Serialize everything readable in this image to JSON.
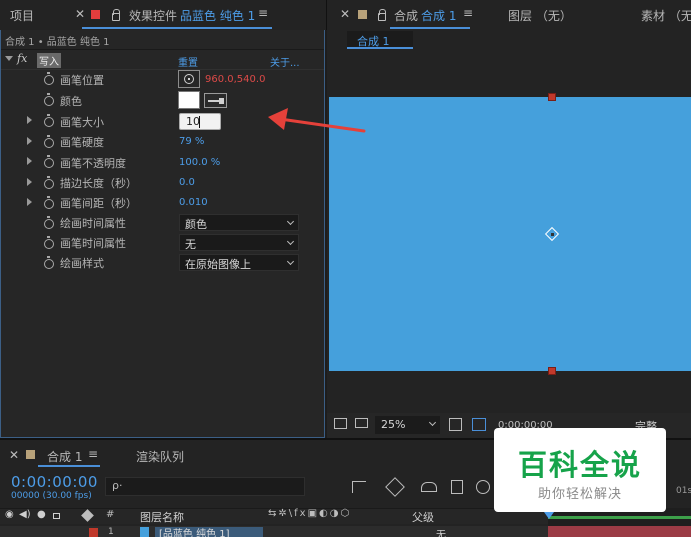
{
  "top_tabs": {
    "project": "项目",
    "effect_controls_prefix": "效果控件",
    "effect_controls_layer": "品蓝色 纯色 1",
    "menu_glyph": "≡",
    "composition_prefix": "合成",
    "composition_name": "合成 1",
    "layer_tab": "图层 （无）",
    "footage_tab": "素材 （无）"
  },
  "effect_controls": {
    "breadcrumb": "合成 1 • 品蓝色 纯色 1",
    "fx_label": "fx",
    "effect_name": "写入",
    "reset": "重置",
    "about": "关于...",
    "properties": [
      {
        "label": "画笔位置",
        "value": "960.0,540.0"
      },
      {
        "label": "颜色"
      },
      {
        "label": "画笔大小",
        "value": "10"
      },
      {
        "label": "画笔硬度",
        "value": "79 %"
      },
      {
        "label": "画笔不透明度",
        "value": "100.0 %"
      },
      {
        "label": "描边长度（秒）",
        "value": "0.0"
      },
      {
        "label": "画笔间距（秒）",
        "value": "0.010"
      },
      {
        "label": "绘画时间属性",
        "value": "颜色"
      },
      {
        "label": "画笔时间属性",
        "value": "无"
      },
      {
        "label": "绘画样式",
        "value": "在原始图像上"
      }
    ]
  },
  "composition": {
    "sub_tab": "合成 1",
    "zoom": "25%",
    "timecode": "0;00;00;00",
    "resolution": "完整",
    "viewer_color": "#45a0dc"
  },
  "timeline": {
    "comp_tab": "合成 1",
    "render_queue": "渲染队列",
    "timecode": "0:00:00:00",
    "frames": "00000 (30.00 fps)",
    "search_glyph": "ρ·",
    "col_hash": "#",
    "col_layer_name": "图层名称",
    "col_parent": "父级",
    "layer_index": "1",
    "layer_name": "[品蓝色 纯色 1]",
    "parent_value": "无",
    "ruler_label": "01s"
  },
  "watermark": {
    "title": "百科全说",
    "subtitle": "助你轻松解决"
  },
  "colors": {
    "accent_blue": "#4a8fd8",
    "value_blue": "#4d9de8",
    "value_red": "#dc4a48",
    "arrow_red": "#e5413a"
  }
}
